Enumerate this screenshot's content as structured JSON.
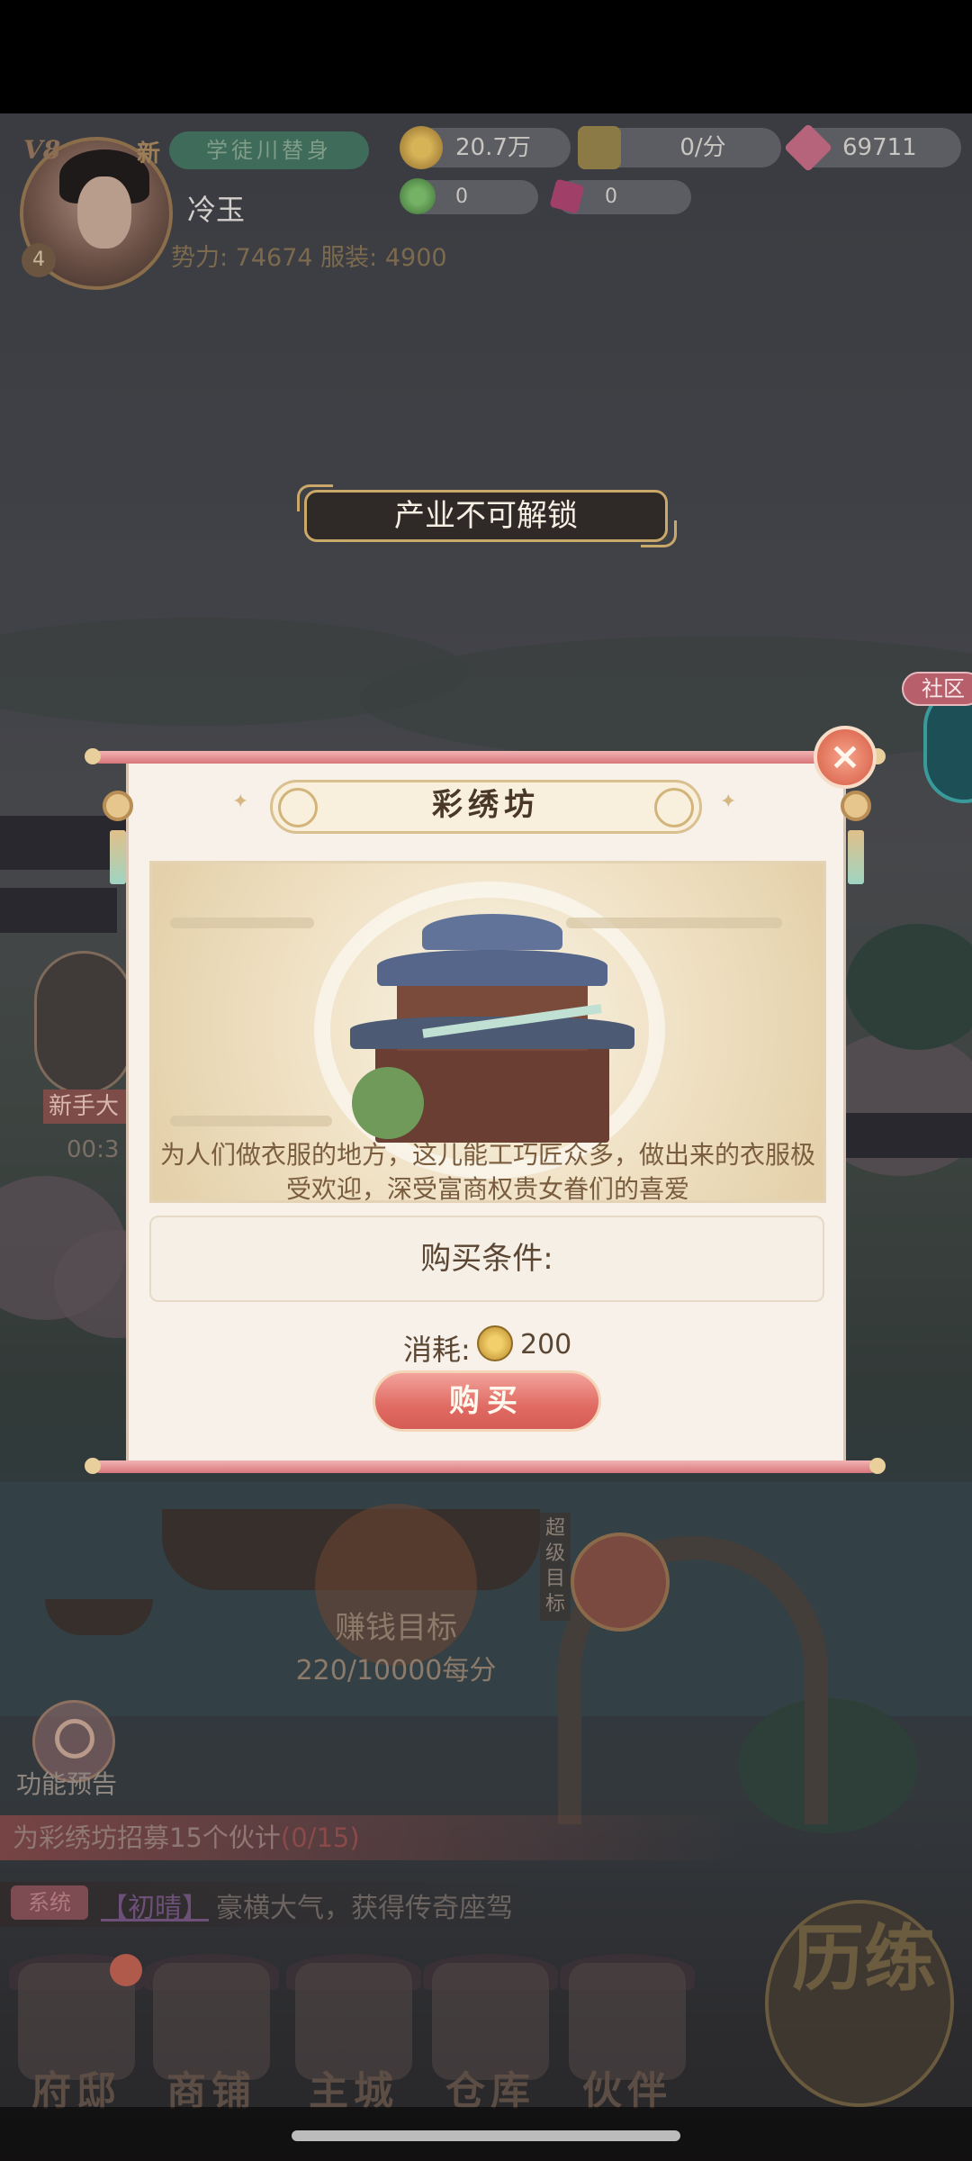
{
  "player": {
    "vip_label": "V8",
    "level": "4",
    "new_tag": "新",
    "title": "学徒川替身",
    "name": "冷玉",
    "stats": "势力: 74674 服装: 4900"
  },
  "resources": {
    "coins": "20.7万",
    "income": "0/分",
    "gems": "69711",
    "green": "0",
    "pink": "0"
  },
  "toast": "产业不可解锁",
  "community": "社区",
  "novice": {
    "label": "新手大",
    "timer": "00:3"
  },
  "modal": {
    "title": "彩绣坊",
    "close_icon": "×",
    "description": "为人们做衣服的地方，这儿能工巧匠众多，做出来的衣服极受欢迎，深受富商权贵女眷们的喜爱",
    "condition_title": "购买条件:",
    "cost_label": "消耗:",
    "cost_value": "200",
    "buy_label": "购买"
  },
  "goal": {
    "title": "赚钱目标",
    "progress": "220/10000每分",
    "super_goal": "超级目标"
  },
  "preview_label": "功能预告",
  "task": {
    "text": "为彩绣坊招募15个伙计",
    "progress": "(0/15)"
  },
  "chat": {
    "tag": "系统",
    "name": "【初晴】",
    "text": "豪横大气，获得传奇座驾"
  },
  "nav": [
    {
      "label": "府邸",
      "icon": "mansion-icon"
    },
    {
      "label": "商铺",
      "icon": "shop-icon"
    },
    {
      "label": "主城",
      "icon": "city-icon"
    },
    {
      "label": "仓库",
      "icon": "warehouse-icon"
    },
    {
      "label": "伙伴",
      "icon": "partner-icon"
    }
  ],
  "train_label": "历练",
  "colors": {
    "accent_pink": "#e06b63",
    "modal_bg": "#f7f1ea",
    "gold": "#c9a86a"
  }
}
